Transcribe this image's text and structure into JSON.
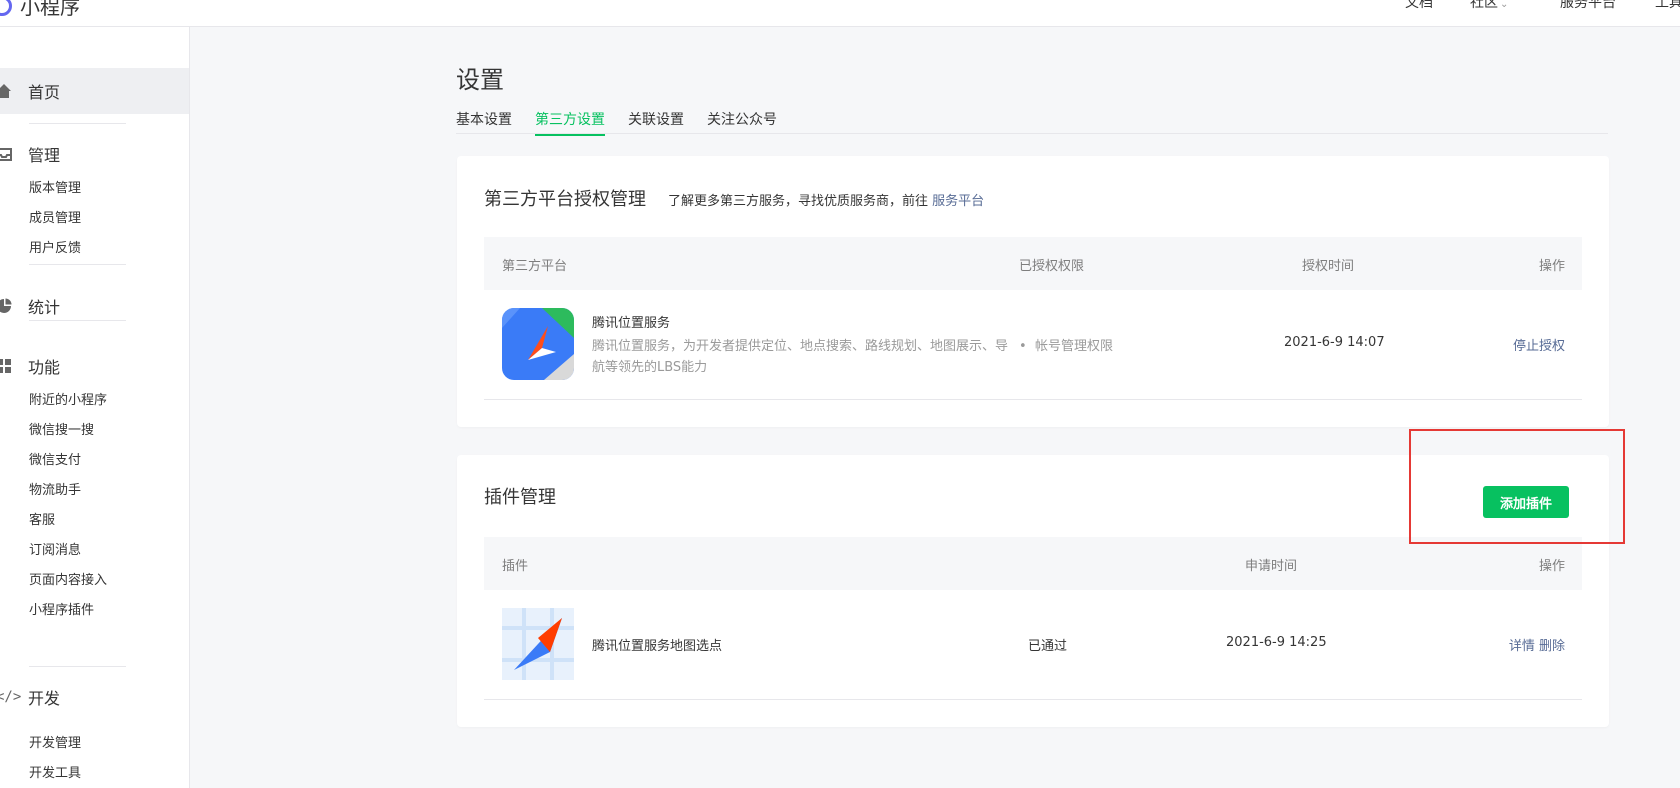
{
  "header": {
    "logo_text": "小程序",
    "nav": {
      "docs": "文档",
      "community": "社区",
      "service": "服务平台",
      "tools": "工具"
    }
  },
  "sidebar": {
    "home": "首页",
    "manage": "管理",
    "manage_items": [
      "版本管理",
      "成员管理",
      "用户反馈"
    ],
    "stats": "统计",
    "features": "功能",
    "feature_items": [
      "附近的小程序",
      "微信搜一搜",
      "微信支付",
      "物流助手",
      "客服",
      "订阅消息",
      "页面内容接入",
      "小程序插件"
    ],
    "develop": "开发",
    "develop_items": [
      "开发管理",
      "开发工具"
    ]
  },
  "page": {
    "title": "设置",
    "tabs": [
      "基本设置",
      "第三方设置",
      "关联设置",
      "关注公众号"
    ],
    "active_tab": "第三方设置"
  },
  "third_party": {
    "title": "第三方平台授权管理",
    "desc": "了解更多第三方服务，寻找优质服务商，前往",
    "desc_link": "服务平台",
    "columns": [
      "第三方平台",
      "已授权权限",
      "授权时间",
      "操作"
    ],
    "rows": [
      {
        "name": "腾讯位置服务",
        "desc_line1": "腾讯位置服务，为开发者提供定位、地点搜索、路线规划、地图展示、导",
        "desc_line2": "航等领先的LBS能力",
        "permission": "帐号管理权限",
        "time": "2021-6-9 14:07",
        "action": "停止授权"
      }
    ]
  },
  "plugins": {
    "title": "插件管理",
    "add_button": "添加插件",
    "columns": [
      "插件",
      "申请时间",
      "操作"
    ],
    "rows": [
      {
        "name": "腾讯位置服务地图选点",
        "status": "已通过",
        "time": "2021-6-9 14:25",
        "action_detail": "详情",
        "action_delete": "删除"
      }
    ]
  },
  "colors": {
    "accent": "#07c160",
    "link": "#576b95",
    "highlight": "#e53935"
  }
}
